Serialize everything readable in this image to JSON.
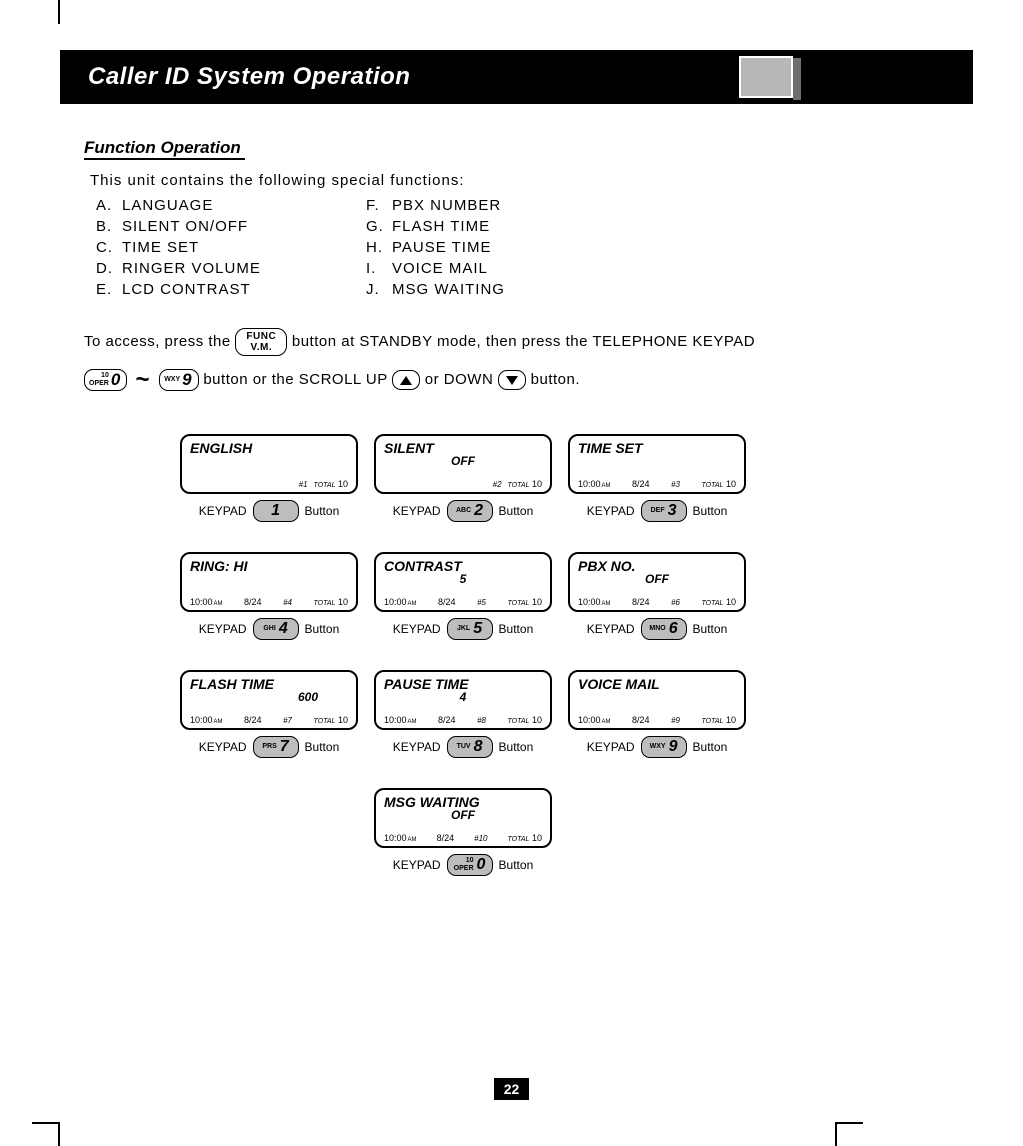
{
  "header": {
    "title": "Caller ID System Operation"
  },
  "section": {
    "title": "Function Operation"
  },
  "intro": "This unit contains the following special functions:",
  "functions": {
    "left": [
      {
        "letter": "A.",
        "label": "LANGUAGE"
      },
      {
        "letter": "B.",
        "label": "SILENT ON/OFF"
      },
      {
        "letter": "C.",
        "label": "TIME SET"
      },
      {
        "letter": "D.",
        "label": "RINGER VOLUME"
      },
      {
        "letter": "E.",
        "label": "LCD CONTRAST"
      }
    ],
    "right": [
      {
        "letter": "F.",
        "label": "PBX NUMBER"
      },
      {
        "letter": "G.",
        "label": "FLASH TIME"
      },
      {
        "letter": "H.",
        "label": "PAUSE TIME"
      },
      {
        "letter": "I.",
        "label": "VOICE MAIL"
      },
      {
        "letter": "J.",
        "label": "MSG WAITING"
      }
    ]
  },
  "access": {
    "part1": "To access, press the",
    "func_line1": "FUNC",
    "func_line2": "V.M.",
    "part2": "button at STANDBY mode, then press the TELEPHONE KEYPAD",
    "key0_top": "10",
    "key0_bot": "OPER",
    "key0_num": "0",
    "tilde": "~",
    "key9_lbl": "WXY",
    "key9_num": "9",
    "part3": "button or the SCROLL UP",
    "part4": "or DOWN",
    "part5": "button."
  },
  "common": {
    "keypad": "KEYPAD",
    "button": "Button",
    "total": "TOTAL"
  },
  "screens": [
    {
      "title": "ENGLISH",
      "sub": "",
      "time": "",
      "date": "",
      "idx": "#1",
      "tval": "10",
      "key_small": "",
      "key_big": "1"
    },
    {
      "title": "SILENT",
      "sub": "OFF",
      "time": "",
      "date": "",
      "idx": "#2",
      "tval": "10",
      "key_small": "ABC",
      "key_big": "2"
    },
    {
      "title": "TIME SET",
      "sub": "",
      "time": "10:00",
      "am": "AM",
      "date": "8/24",
      "idx": "#3",
      "tval": "10",
      "key_small": "DEF",
      "key_big": "3"
    },
    {
      "title": "RING: HI",
      "sub": "",
      "time": "10:00",
      "am": "AM",
      "date": "8/24",
      "idx": "#4",
      "tval": "10",
      "key_small": "GHI",
      "key_big": "4"
    },
    {
      "title": "CONTRAST",
      "sub": "5",
      "time": "10:00",
      "am": "AM",
      "date": "8/24",
      "idx": "#5",
      "tval": "10",
      "key_small": "JKL",
      "key_big": "5"
    },
    {
      "title": "PBX NO.",
      "sub": "OFF",
      "time": "10:00",
      "am": "AM",
      "date": "8/24",
      "idx": "#6",
      "tval": "10",
      "key_small": "MNO",
      "key_big": "6"
    },
    {
      "title": "FLASH TIME",
      "sub": "600",
      "time": "10:00",
      "am": "AM",
      "date": "8/24",
      "idx": "#7",
      "tval": "10",
      "key_small": "PRS",
      "key_big": "7"
    },
    {
      "title": "PAUSE TIME",
      "sub": "4",
      "time": "10:00",
      "am": "AM",
      "date": "8/24",
      "idx": "#8",
      "tval": "10",
      "key_small": "TUV",
      "key_big": "8"
    },
    {
      "title": "VOICE MAIL",
      "sub": "",
      "time": "10:00",
      "am": "AM",
      "date": "8/24",
      "idx": "#9",
      "tval": "10",
      "key_small": "WXY",
      "key_big": "9"
    },
    {
      "title": "MSG WAITING",
      "sub": "OFF",
      "time": "10:00",
      "am": "AM",
      "date": "8/24",
      "idx": "#10",
      "tval": "10",
      "key_small_top": "10",
      "key_small_bot": "OPER",
      "key_big": "0"
    }
  ],
  "page_number": "22"
}
